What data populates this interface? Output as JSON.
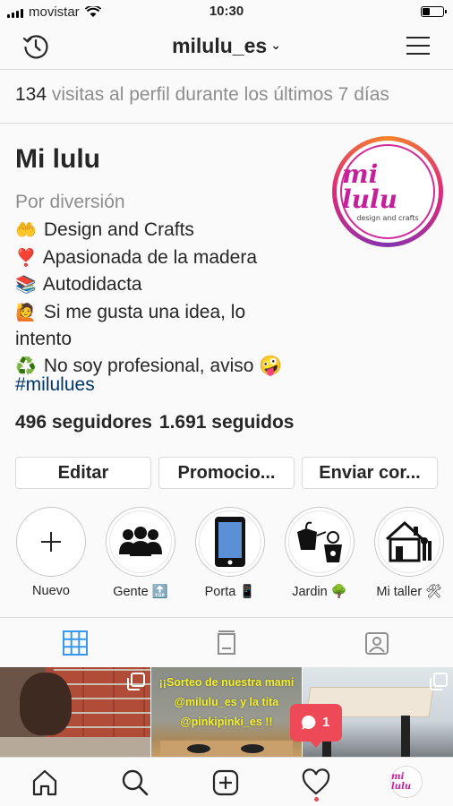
{
  "status_bar": {
    "carrier": "movistar",
    "time": "10:30",
    "battery_level": 0.35
  },
  "nav": {
    "username": "milulu_es",
    "chevron": "⌄"
  },
  "visits": {
    "count": "134",
    "text": " visitas al perfil durante los últimos 7 días"
  },
  "profile": {
    "name": "Mi lulu",
    "category": "Por diversión",
    "bio": [
      {
        "emoji": "🤲",
        "text": "Design and Crafts"
      },
      {
        "emoji": "❣️",
        "text": "Apasionada de la madera"
      },
      {
        "emoji": "📚",
        "text": "Autodidacta"
      },
      {
        "emoji": "🙋",
        "text": "Si me gusta una idea, lo"
      },
      {
        "emoji": "",
        "text": "intento"
      },
      {
        "emoji": "♻️",
        "text": "No soy profesional, aviso 🤪"
      }
    ],
    "hashtag": "#milulues",
    "followers": "496 seguidores",
    "following": "1.691 seguidos",
    "avatar_logo": "mi lulu",
    "avatar_sub": "design and crafts"
  },
  "buttons": {
    "edit": "Editar",
    "promote": "Promocio...",
    "send": "Enviar cor..."
  },
  "stories": [
    {
      "label": "Nuevo",
      "icon": "plus-icon"
    },
    {
      "label": "Gente 🔝",
      "icon": "people-icon"
    },
    {
      "label": "Porta 📱",
      "icon": "phone-icon"
    },
    {
      "label": "Jardin 🌳",
      "icon": "garden-icon"
    },
    {
      "label": "Mi taller 🛠",
      "icon": "workshop-icon"
    }
  ],
  "grid": {
    "post2_line1": "¡¡Sorteo de nuestra mami",
    "post2_line2": "@milulu_es y la tita",
    "post2_line3": "@pinkipinki_es !!"
  },
  "notification": {
    "count": "1"
  },
  "colors": {
    "accent": "#3897f0",
    "badge": "#ed4956",
    "link": "#003569",
    "brand": "#c4209a"
  }
}
